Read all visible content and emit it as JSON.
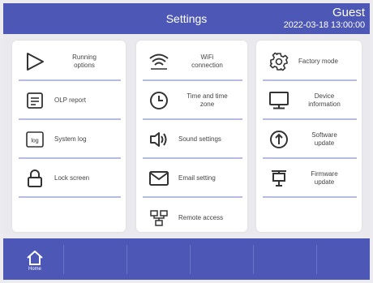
{
  "header": {
    "title": "Settings",
    "user": "Guest",
    "datetime": "2022-03-18 13:00:00"
  },
  "panels": {
    "left": [
      {
        "label": "Running\noptions",
        "icon": "play-icon"
      },
      {
        "label": "OLP report",
        "icon": "report-icon"
      },
      {
        "label": "System log",
        "icon": "log-icon"
      },
      {
        "label": "Lock screen",
        "icon": "lock-icon"
      }
    ],
    "middle": [
      {
        "label": "WiFi\nconnection",
        "icon": "wifi-icon"
      },
      {
        "label": "Time and time\nzone",
        "icon": "clock-icon"
      },
      {
        "label": "Sound settings",
        "icon": "speaker-icon"
      },
      {
        "label": "Email setting",
        "icon": "email-icon"
      },
      {
        "label": "Remote access",
        "icon": "network-icon"
      }
    ],
    "right": [
      {
        "label": "Factory mode",
        "icon": "gear-icon"
      },
      {
        "label": "Device\ninformation",
        "icon": "monitor-icon"
      },
      {
        "label": "Software\nupdate",
        "icon": "upload-icon"
      },
      {
        "label": "Firmware\nupdate",
        "icon": "chip-icon"
      }
    ]
  },
  "footer": {
    "home_label": "Home"
  },
  "colors": {
    "header_bg": "#4d58b6",
    "separator": "#b6bce4"
  }
}
